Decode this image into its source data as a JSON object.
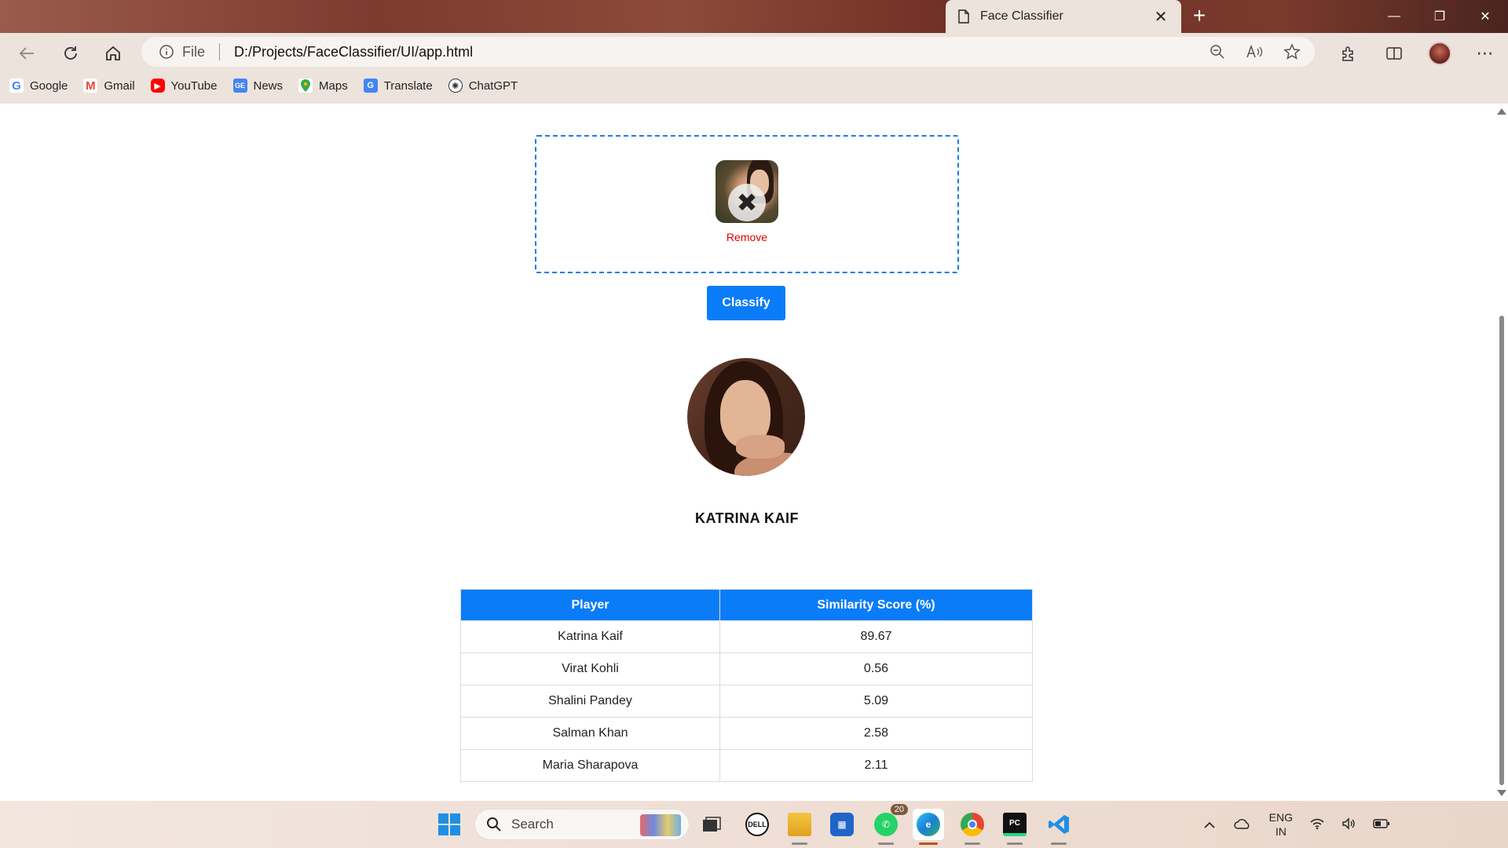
{
  "browser": {
    "tab_title": "Face Classifier",
    "address_scheme": "File",
    "address_url": "D:/Projects/FaceClassifier/UI/app.html",
    "bookmarks": [
      {
        "label": "Google",
        "icon": "google-icon",
        "color": "#4285f4"
      },
      {
        "label": "Gmail",
        "icon": "gmail-icon",
        "color": "#ea4335"
      },
      {
        "label": "YouTube",
        "icon": "youtube-icon",
        "color": "#ff0000"
      },
      {
        "label": "News",
        "icon": "news-icon",
        "color": "#4285f4"
      },
      {
        "label": "Maps",
        "icon": "maps-icon",
        "color": "#34a853"
      },
      {
        "label": "Translate",
        "icon": "translate-icon",
        "color": "#4285f4"
      },
      {
        "label": "ChatGPT",
        "icon": "chatgpt-icon",
        "color": "#333333"
      }
    ]
  },
  "upload": {
    "remove_label": "Remove",
    "classify_label": "Classify"
  },
  "result": {
    "name": "KATRINA KAIF"
  },
  "table": {
    "headers": [
      "Player",
      "Similarity Score (%)"
    ],
    "rows": [
      [
        "Katrina Kaif",
        "89.67"
      ],
      [
        "Virat Kohli",
        "0.56"
      ],
      [
        "Shalini Pandey",
        "5.09"
      ],
      [
        "Salman Khan",
        "2.58"
      ],
      [
        "Maria Sharapova",
        "2.11"
      ]
    ]
  },
  "taskbar": {
    "search_placeholder": "Search",
    "whatsapp_badge": "20",
    "lang_line1": "ENG",
    "lang_line2": "IN"
  },
  "colors": {
    "accent": "#0a7cf8",
    "remove": "#e00000"
  }
}
